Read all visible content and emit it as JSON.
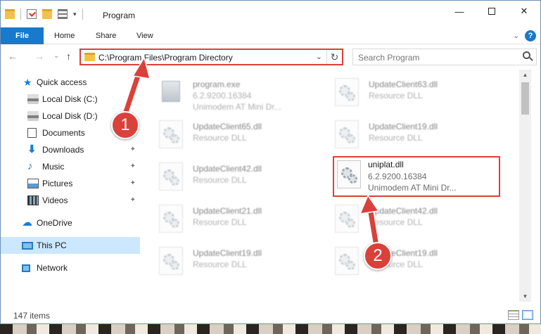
{
  "window": {
    "title": "Program",
    "controls": {
      "minimize": "—",
      "maximize": "",
      "close": "✕"
    }
  },
  "ribbon": {
    "tabs": [
      "File",
      "Home",
      "Share",
      "View"
    ],
    "help": "?",
    "collapse": "⌄"
  },
  "navigation": {
    "back": "←",
    "forward": "→",
    "recent": "⌄",
    "up": "↑",
    "address": "C:\\Program Files\\Program Directory",
    "address_dropdown": "⌄",
    "refresh": "↻",
    "search_placeholder": "Search Program"
  },
  "sidebar": {
    "items": [
      {
        "label": "Quick access",
        "icon": "star-icon",
        "pinned": false
      },
      {
        "label": "Local Disk (C:)",
        "icon": "drive-icon",
        "pinned": true
      },
      {
        "label": "Local Disk (D:)",
        "icon": "drive-icon",
        "pinned": true
      },
      {
        "label": "Documents",
        "icon": "documents-icon",
        "pinned": true
      },
      {
        "label": "Downloads",
        "icon": "download-icon",
        "pinned": true
      },
      {
        "label": "Music",
        "icon": "music-icon",
        "pinned": true
      },
      {
        "label": "Pictures",
        "icon": "pictures-icon",
        "pinned": true
      },
      {
        "label": "Videos",
        "icon": "videos-icon",
        "pinned": true
      },
      {
        "label": "OneDrive",
        "icon": "cloud-icon",
        "pinned": false
      },
      {
        "label": "This PC",
        "icon": "computer-icon",
        "pinned": false,
        "selected": true
      },
      {
        "label": "Network",
        "icon": "network-icon",
        "pinned": false
      }
    ],
    "pin_glyph": "📌"
  },
  "files": [
    {
      "name": "program.exe",
      "line2": "6.2.9200.16384",
      "line3": "Unimodem AT Mini Dr...",
      "type": "exe",
      "blurred": true
    },
    {
      "name": "UpdateClient63.dll",
      "line2": "Resource DLL",
      "line3": "",
      "type": "dll",
      "blurred": true
    },
    {
      "name": "UpdateClient65.dll",
      "line2": "Resource DLL",
      "line3": "",
      "type": "dll",
      "blurred": true
    },
    {
      "name": "UpdateClient19.dll",
      "line2": "Resource DLL",
      "line3": "",
      "type": "dll",
      "blurred": true
    },
    {
      "name": "UpdateClient42.dll",
      "line2": "Resource DLL",
      "line3": "",
      "type": "dll",
      "blurred": true
    },
    {
      "name": "uniplat.dll",
      "line2": "6.2.9200.16384",
      "line3": "Unimodem AT Mini Dr...",
      "type": "dll",
      "blurred": false,
      "highlighted": true
    },
    {
      "name": "UpdateClient21.dll",
      "line2": "Resource DLL",
      "line3": "",
      "type": "dll",
      "blurred": true
    },
    {
      "name": "UpdateClient42.dll",
      "line2": "Resource DLL",
      "line3": "",
      "type": "dll",
      "blurred": true
    },
    {
      "name": "UpdateClient19.dll",
      "line2": "Resource DLL",
      "line3": "",
      "type": "dll",
      "blurred": true
    },
    {
      "name": "UpdateClient19.dll",
      "line2": "Resource DLL",
      "line3": "",
      "type": "dll",
      "blurred": true
    }
  ],
  "status": {
    "item_count": "147 items"
  },
  "scrollbar": {
    "up": "▲",
    "down": "▼"
  },
  "annotations": {
    "step1": "1",
    "step2": "2",
    "color": "#d9413a"
  }
}
